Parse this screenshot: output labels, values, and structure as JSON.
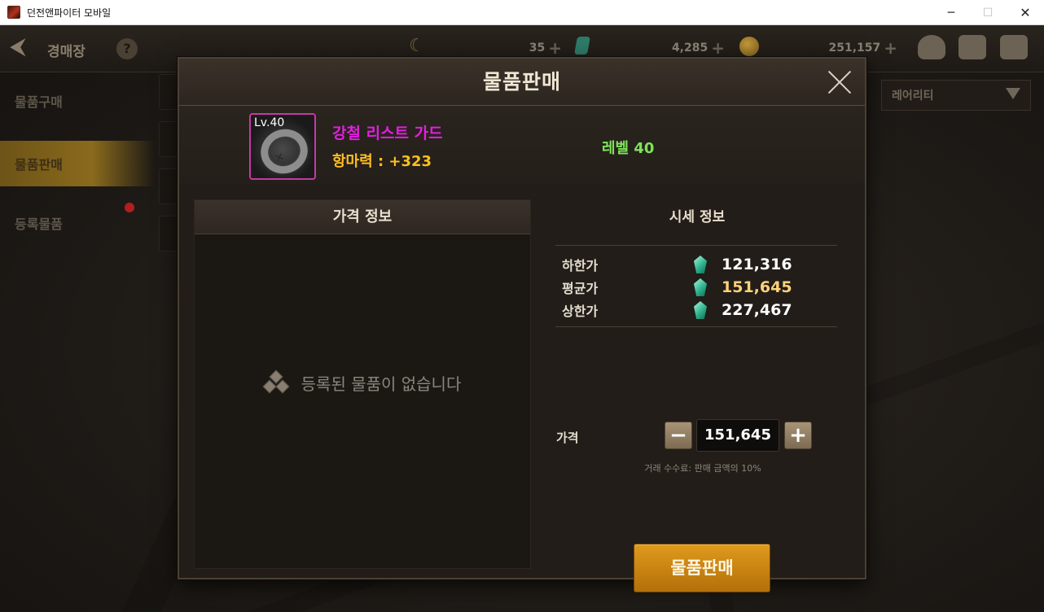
{
  "window": {
    "title": "던전앤파이터 모바일",
    "min_label": "─",
    "max_label": "☐",
    "close_label": "✕"
  },
  "hud": {
    "back_label": "⮜",
    "title": "경매장",
    "help_label": "?",
    "currency_1": "35",
    "currency_2": "4,285",
    "currency_3": "251,157",
    "currency_plus": "+",
    "moon_glyph": "☾"
  },
  "sidebar": {
    "items": [
      {
        "label": "물품구매"
      },
      {
        "label": "물품판매"
      },
      {
        "label": "등록물품"
      }
    ]
  },
  "filter": {
    "rarity_label": "레어리티"
  },
  "modal": {
    "title": "물품판매",
    "item": {
      "level_badge": "Lv.40",
      "name": "강철 리스트 가드",
      "stat": "항마력 : +323",
      "level_text": "레벨 40",
      "rarity_color": "#e31ee0"
    },
    "price_panel": {
      "header": "가격 정보",
      "empty_text": "등록된 물품이 없습니다"
    },
    "market": {
      "title": "시세 정보",
      "rows": [
        {
          "label": "하한가",
          "value": "121,316"
        },
        {
          "label": "평균가",
          "value": "151,645"
        },
        {
          "label": "상한가",
          "value": "227,467"
        }
      ]
    },
    "price": {
      "label": "가격",
      "value": "151,645",
      "minus_label": "−",
      "plus_label": "+",
      "fee_note": "거래 수수료: 판매 금액의 10%"
    },
    "sell_button": "물품판매"
  }
}
